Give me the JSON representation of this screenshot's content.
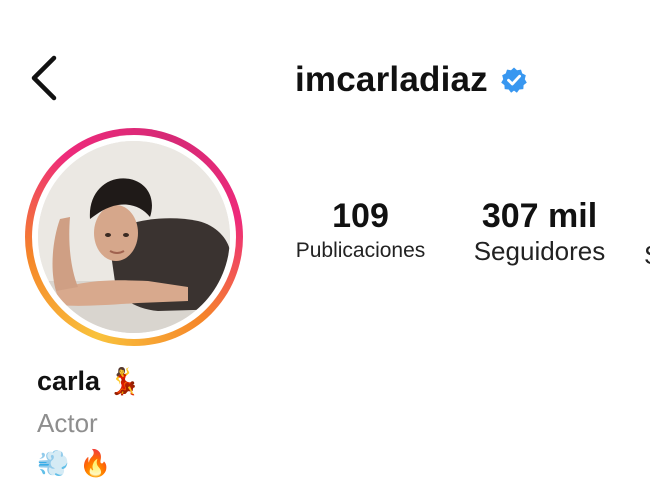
{
  "header": {
    "username": "imcarladiaz",
    "verified_color": "#3897f0"
  },
  "stats": {
    "posts": {
      "value": "109",
      "label": "Publicaciones"
    },
    "followers": {
      "value": "307 mil",
      "label": "Seguidores"
    },
    "next_label_partial": "S"
  },
  "profile": {
    "name": "carla",
    "name_emoji": "💃",
    "category": "Actor",
    "bio_emojis": [
      "💨",
      "🔥"
    ]
  },
  "colors": {
    "ring_gradient": [
      "#f9c23c",
      "#f58529",
      "#ee2a7b",
      "#d62976"
    ],
    "text": "#111111",
    "muted": "#8e8e8e"
  },
  "icons": {
    "back": "chevron-left-icon",
    "verified": "verified-badge-icon"
  }
}
